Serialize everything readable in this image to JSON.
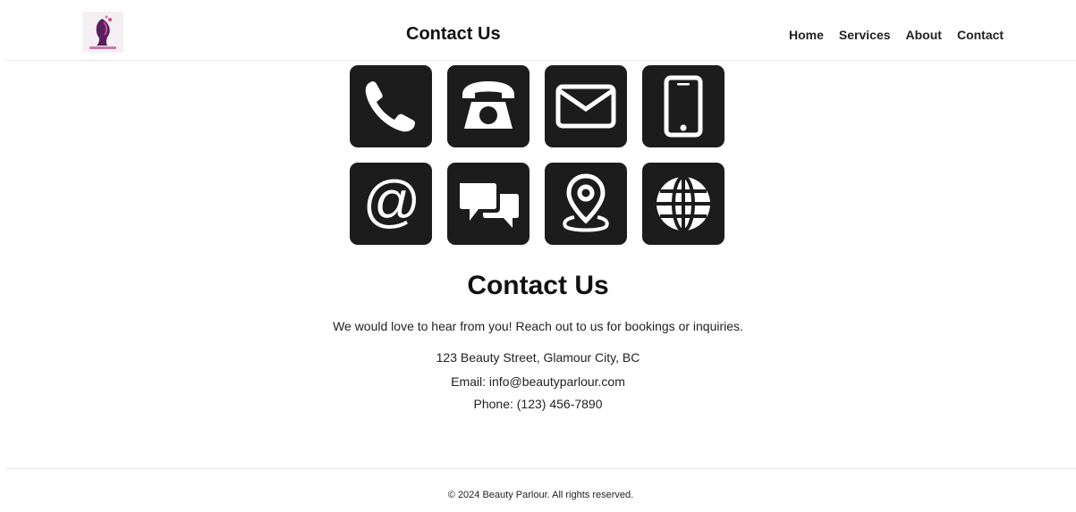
{
  "header": {
    "title": "Contact Us",
    "nav": [
      "Home",
      "Services",
      "About",
      "Contact"
    ]
  },
  "icons": [
    "phone-handset-icon",
    "telephone-icon",
    "envelope-icon",
    "mobile-phone-icon",
    "at-sign-icon",
    "chat-bubbles-icon",
    "location-pin-icon",
    "globe-icon"
  ],
  "main": {
    "title": "Contact Us",
    "intro": "We would love to hear from you! Reach out to us for bookings or inquiries.",
    "address": "123 Beauty Street, Glamour City, BC",
    "email": "Email: info@beautyparlour.com",
    "phone": "Phone: (123) 456-7890"
  },
  "footer": {
    "text": "© 2024 Beauty Parlour. All rights reserved."
  },
  "colors": {
    "tile": "#1c1c1c",
    "text": "#111111",
    "logo_accent": "#7a2a7a"
  }
}
